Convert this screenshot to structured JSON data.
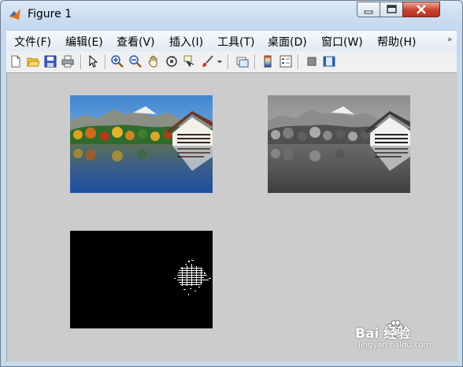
{
  "window": {
    "title": "Figure 1"
  },
  "menu": [
    {
      "label": "文件(F)"
    },
    {
      "label": "编辑(E)"
    },
    {
      "label": "查看(V)"
    },
    {
      "label": "插入(I)"
    },
    {
      "label": "工具(T)"
    },
    {
      "label": "桌面(D)"
    },
    {
      "label": "窗口(W)"
    },
    {
      "label": "帮助(H)"
    }
  ],
  "toolbar": {
    "icons": [
      "new-figure-icon",
      "open-file-icon",
      "save-icon",
      "print-icon",
      "select-arrow-icon",
      "zoom-in-icon",
      "zoom-out-icon",
      "pan-hand-icon",
      "rotate-3d-icon",
      "data-cursor-icon",
      "brush-icon",
      "brush-dropdown-icon",
      "link-plot-icon",
      "colorbar-icon",
      "legend-icon",
      "hide-plot-tools-icon",
      "show-plot-tools-icon"
    ]
  },
  "axes": [
    {
      "content": "color photograph of lake with mountains and chalet",
      "colormap": "color"
    },
    {
      "content": "grayscale version of photograph",
      "colormap": "gray"
    },
    {
      "content": "binary image, black with white chalet edges",
      "colormap": "binary"
    }
  ],
  "watermark": {
    "main": "Bai 经验",
    "sub": "jingyan.baidu.com"
  }
}
